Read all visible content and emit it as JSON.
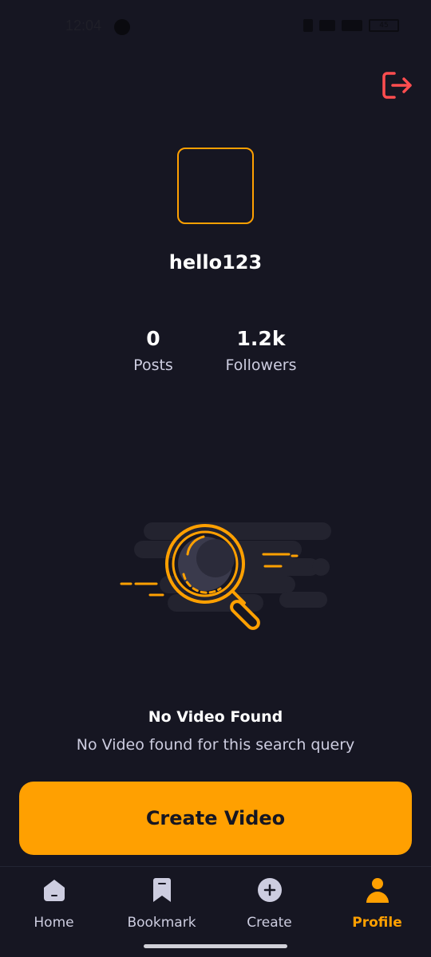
{
  "status_bar": {
    "time": "12:04",
    "battery": "45"
  },
  "profile": {
    "username": "hello123",
    "stats": [
      {
        "value": "0",
        "label": "Posts"
      },
      {
        "value": "1.2k",
        "label": "Followers"
      }
    ]
  },
  "empty_state": {
    "title": "No Video Found",
    "subtitle": "No Video found for this search query"
  },
  "create_button": {
    "label": "Create Video"
  },
  "tab_bar": {
    "tabs": [
      {
        "label": "Home",
        "icon": "home-icon"
      },
      {
        "label": "Bookmark",
        "icon": "bookmark-icon"
      },
      {
        "label": "Create",
        "icon": "plus-circle-icon"
      },
      {
        "label": "Profile",
        "icon": "profile-icon",
        "active": true
      }
    ]
  },
  "colors": {
    "background": "#161622",
    "accent": "#FFA001",
    "logout": "#FF4D4F",
    "muted": "#CDCDE0"
  }
}
